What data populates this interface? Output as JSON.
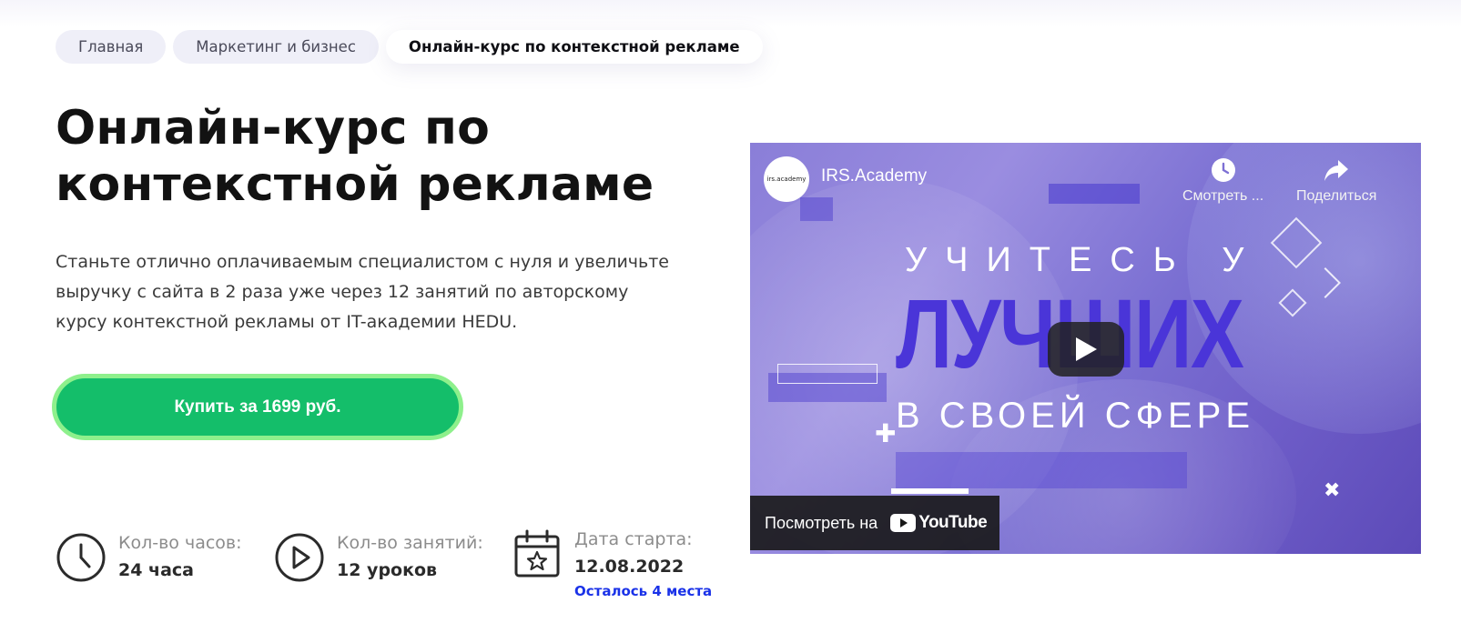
{
  "breadcrumbs": [
    "Главная",
    "Маркетинг и бизнес",
    "Онлайн-курс по контекстной рекламе"
  ],
  "course": {
    "title": "Онлайн-курс по контекстной рекламе",
    "description": "Станьте отлично оплачиваемым специалистом с нуля и увеличьте выручку с сайта в 2 раза уже через 12 занятий по авторскому курсу контекстной рекламы от IT-академии HEDU.",
    "buy_label": "Купить за 1699 руб."
  },
  "stats": {
    "hours": {
      "label": "Кол-во часов:",
      "value": "24 часа",
      "icon": "clock-icon"
    },
    "lessons": {
      "label": "Кол-во занятий:",
      "value": "12 уроков",
      "icon": "play-circle-icon"
    },
    "start": {
      "label": "Дата старта:",
      "value": "12.08.2022",
      "note": "Осталось 4 места",
      "icon": "calendar-star-icon"
    }
  },
  "video": {
    "channel_avatar_text": "irs.academy",
    "channel_name": "IRS.Academy",
    "watch_later_label": "Смотреть ...",
    "share_label": "Поделиться",
    "headline_line1": "УЧИТЕСЬ У",
    "headline_line2": "ЛУЧШИХ",
    "headline_line3": "В СВОЕЙ СФЕРЕ",
    "watch_on_label": "Посмотреть на",
    "youtube_wordmark": "YouTube"
  },
  "colors": {
    "accent_green": "#14be6a",
    "button_outline": "#8ef08c",
    "note_blue": "#1a32e8",
    "video_headline_blue": "#4a35d8"
  }
}
